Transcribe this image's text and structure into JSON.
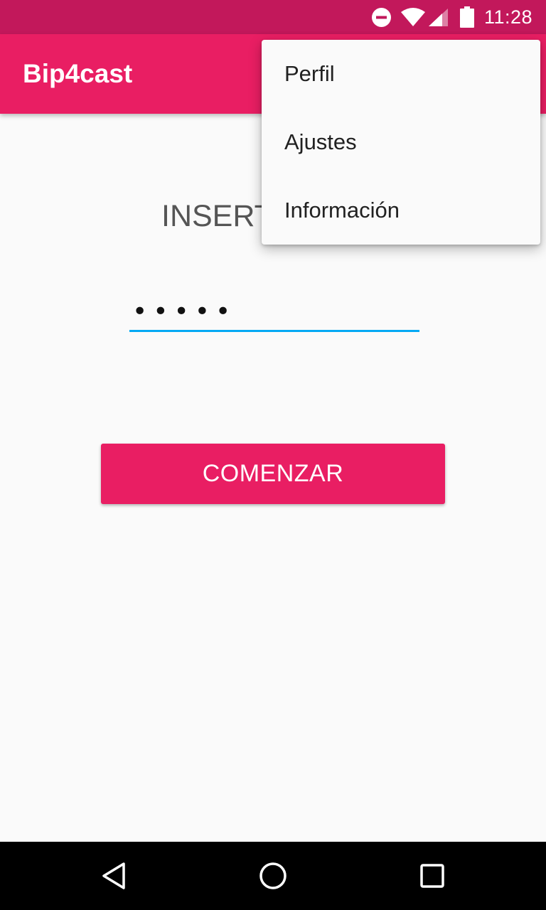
{
  "status_bar": {
    "time": "11:28",
    "icons": [
      "do-not-disturb-icon",
      "wifi-icon",
      "signal-icon",
      "battery-icon"
    ],
    "background_color": "#c2185b"
  },
  "app_bar": {
    "title": "Bip4cast",
    "background_color": "#e91e63"
  },
  "main": {
    "prompt_label": "INSERT",
    "password_value": "•••••",
    "start_button_label": "COMENZAR",
    "field_underline_color": "#03a9f4"
  },
  "overflow_menu": {
    "items": [
      {
        "label": "Perfil"
      },
      {
        "label": "Ajustes"
      },
      {
        "label": "Información"
      }
    ]
  },
  "nav_bar": {
    "buttons": [
      "back-icon",
      "home-icon",
      "recents-icon"
    ]
  }
}
